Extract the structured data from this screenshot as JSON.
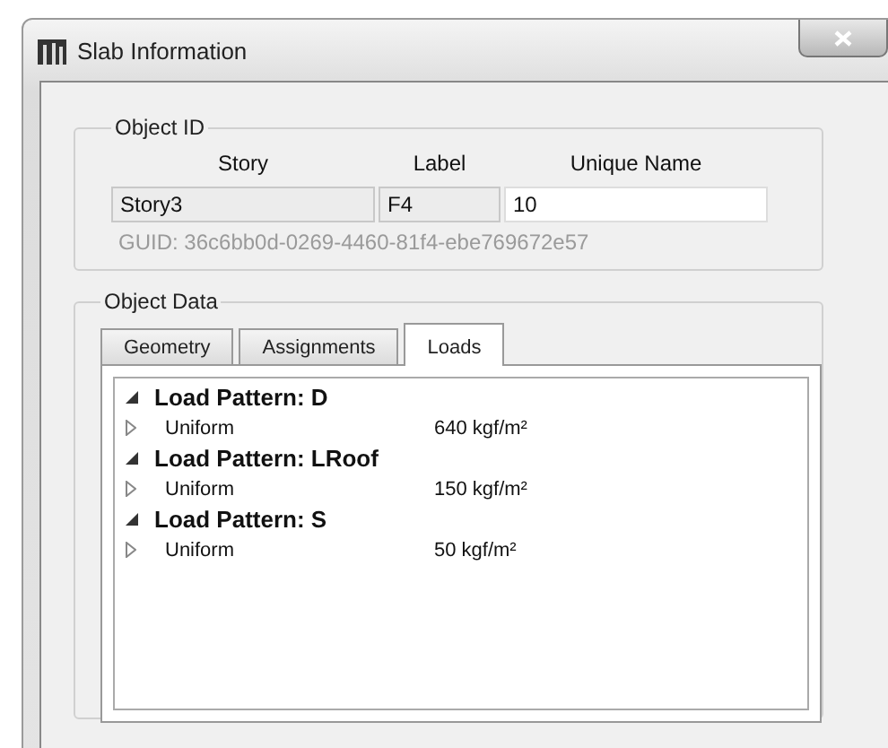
{
  "window": {
    "title": "Slab Information"
  },
  "object_id": {
    "title": "Object ID",
    "columns": [
      "Story",
      "Label",
      "Unique Name"
    ],
    "fields": [
      {
        "value": "Story3",
        "editable": false
      },
      {
        "value": "F4",
        "editable": false
      },
      {
        "value": "10",
        "editable": true
      }
    ],
    "guid": "GUID:  36c6bb0d-0269-4460-81f4-ebe769672e57"
  },
  "object_data": {
    "title": "Object Data",
    "tabs": [
      {
        "label": "Geometry",
        "selected": false
      },
      {
        "label": "Assignments",
        "selected": false
      },
      {
        "label": "Loads",
        "selected": true
      }
    ],
    "tree": [
      {
        "label": "Load Pattern: D",
        "expanded": true,
        "children": [
          {
            "name": "Uniform",
            "value": "640 kgf/m²",
            "expanded": false
          }
        ]
      },
      {
        "label": "Load Pattern: LRoof",
        "expanded": true,
        "children": [
          {
            "name": "Uniform",
            "value": "150 kgf/m²",
            "expanded": false
          }
        ]
      },
      {
        "label": "Load Pattern: S",
        "expanded": true,
        "children": [
          {
            "name": "Uniform",
            "value": "50 kgf/m²",
            "expanded": false
          }
        ]
      }
    ]
  }
}
